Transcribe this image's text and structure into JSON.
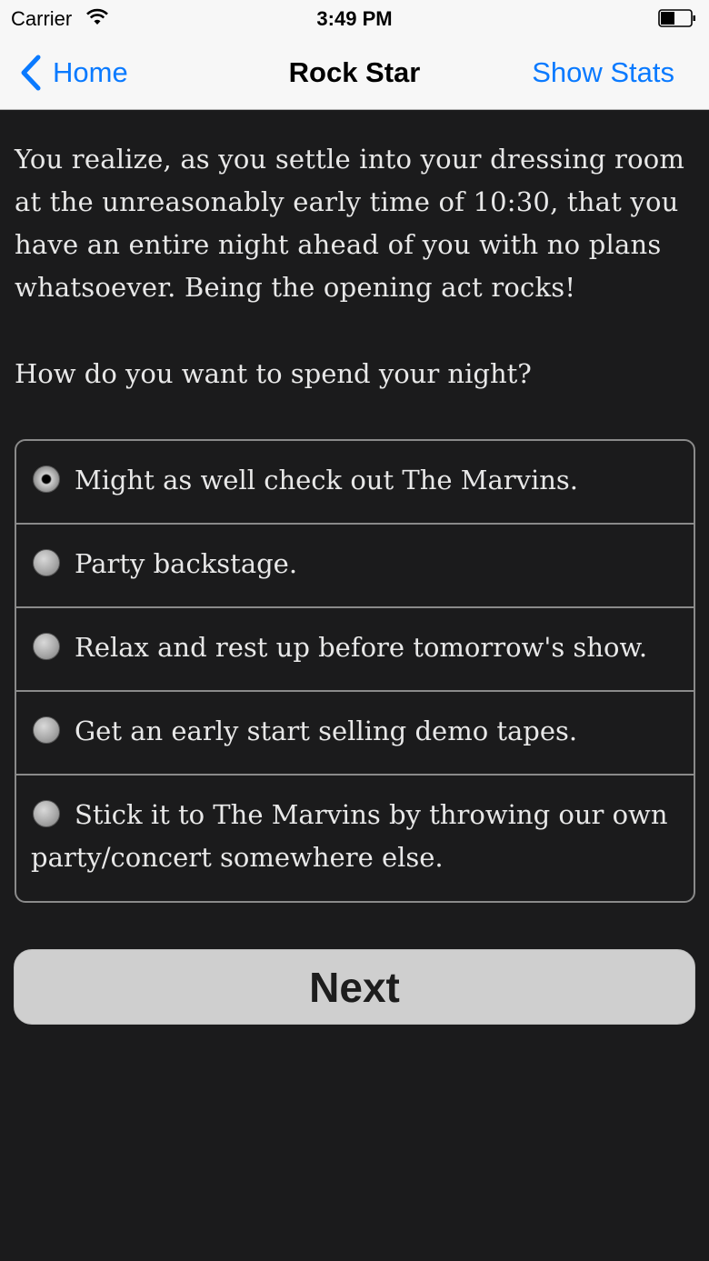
{
  "status_bar": {
    "carrier": "Carrier",
    "time": "3:49 PM"
  },
  "nav": {
    "back_label": "Home",
    "title": "Rock Star",
    "stats_label": "Show Stats",
    "accent_color": "#0a7aff"
  },
  "story": {
    "text": "You realize, as you settle into your dressing room at the unreasonably early time of 10:30, that you have an entire night ahead of you with no plans whatsoever. Being the opening act rocks!",
    "question": "How do you want to spend your night?"
  },
  "choices": [
    {
      "label": "Might as well check out The Marvins.",
      "selected": true
    },
    {
      "label": "Party backstage.",
      "selected": false
    },
    {
      "label": "Relax and rest up before tomorrow's show.",
      "selected": false
    },
    {
      "label": "Get an early start selling demo tapes.",
      "selected": false
    },
    {
      "label": "Stick it to The Marvins by throwing our own party/concert somewhere else.",
      "selected": false
    }
  ],
  "next_label": "Next"
}
